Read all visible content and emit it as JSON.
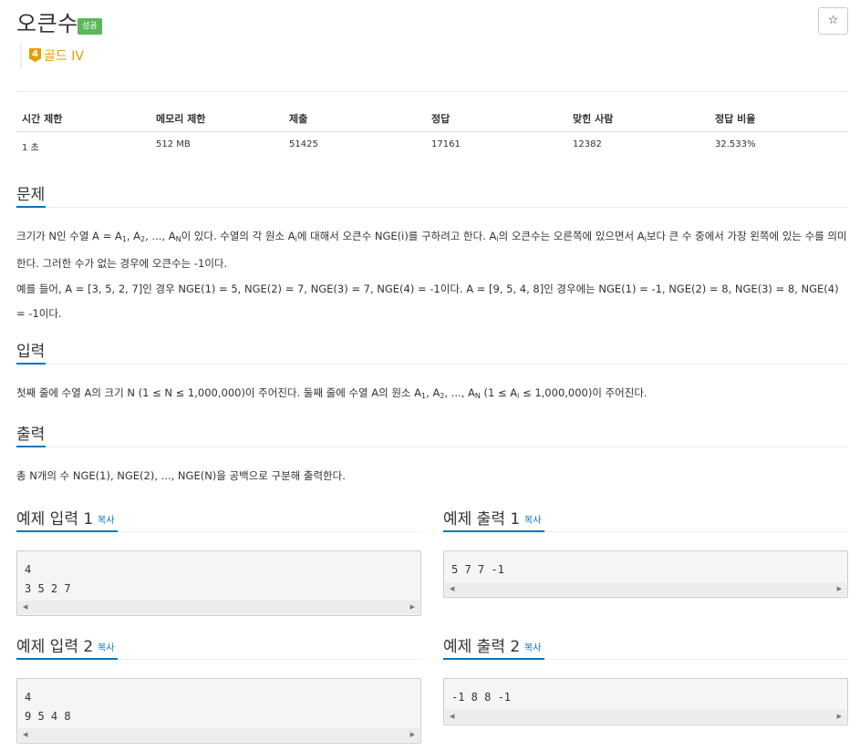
{
  "header": {
    "title": "오큰수",
    "badge": "성공",
    "star": "☆",
    "tier_number": "4",
    "tier_label": "골드 IV"
  },
  "stats": {
    "headers": [
      "시간 제한",
      "메모리 제한",
      "제출",
      "정답",
      "맞힌 사람",
      "정답 비율"
    ],
    "values": [
      "1 초",
      "512 MB",
      "51425",
      "17161",
      "12382",
      "32.533%"
    ]
  },
  "problem": {
    "heading": "문제",
    "p1_a": "크기가 N인 수열 A = A",
    "p1_sub1": "1",
    "p1_b": ", A",
    "p1_sub2": "2",
    "p1_c": ", ..., A",
    "p1_subN": "N",
    "p1_d": "이 있다. 수열의 각 원소 A",
    "p1_subi": "i",
    "p1_e": "에 대해서 오큰수 NGE(i)를 구하려고 한다. A",
    "p1_subi2": "i",
    "p1_f": "의 오큰수는 오른쪽에 있으면서 A",
    "p1_subi3": "i",
    "p1_g": "보다 큰 수 중에서 가장 왼쪽에 있는 수를 의미한다. 그러한 수가 없는 경우에 오큰수는 -1이다.",
    "p2": "예를 들어, A = [3, 5, 2, 7]인 경우 NGE(1) = 5, NGE(2) = 7, NGE(3) = 7, NGE(4) = -1이다. A = [9, 5, 4, 8]인 경우에는 NGE(1) = -1, NGE(2) = 8, NGE(3) = 8, NGE(4) = -1이다."
  },
  "input": {
    "heading": "입력",
    "t_a": "첫째 줄에 수열 A의 크기 N (1 ≤ N ≤ 1,000,000)이 주어진다. 둘째 줄에 수열 A의 원소 A",
    "sub1": "1",
    "t_b": ", A",
    "sub2": "2",
    "t_c": ", ..., A",
    "subN": "N",
    "t_d": " (1 ≤ A",
    "subi": "i",
    "t_e": " ≤ 1,000,000)이 주어진다."
  },
  "output": {
    "heading": "출력",
    "text": "총 N개의 수 NGE(1), NGE(2), ..., NGE(N)을 공백으로 구분해 출력한다."
  },
  "samples": {
    "copy_label": "복사",
    "in1_title": "예제 입력 1",
    "in1_text": "4\n3 5 2 7",
    "out1_title": "예제 출력 1",
    "out1_text": "5 7 7 -1",
    "in2_title": "예제 입력 2",
    "in2_text": "4\n9 5 4 8",
    "out2_title": "예제 출력 2",
    "out2_text": "-1 8 8 -1",
    "arrow_left": "◀",
    "arrow_right": "▶"
  }
}
